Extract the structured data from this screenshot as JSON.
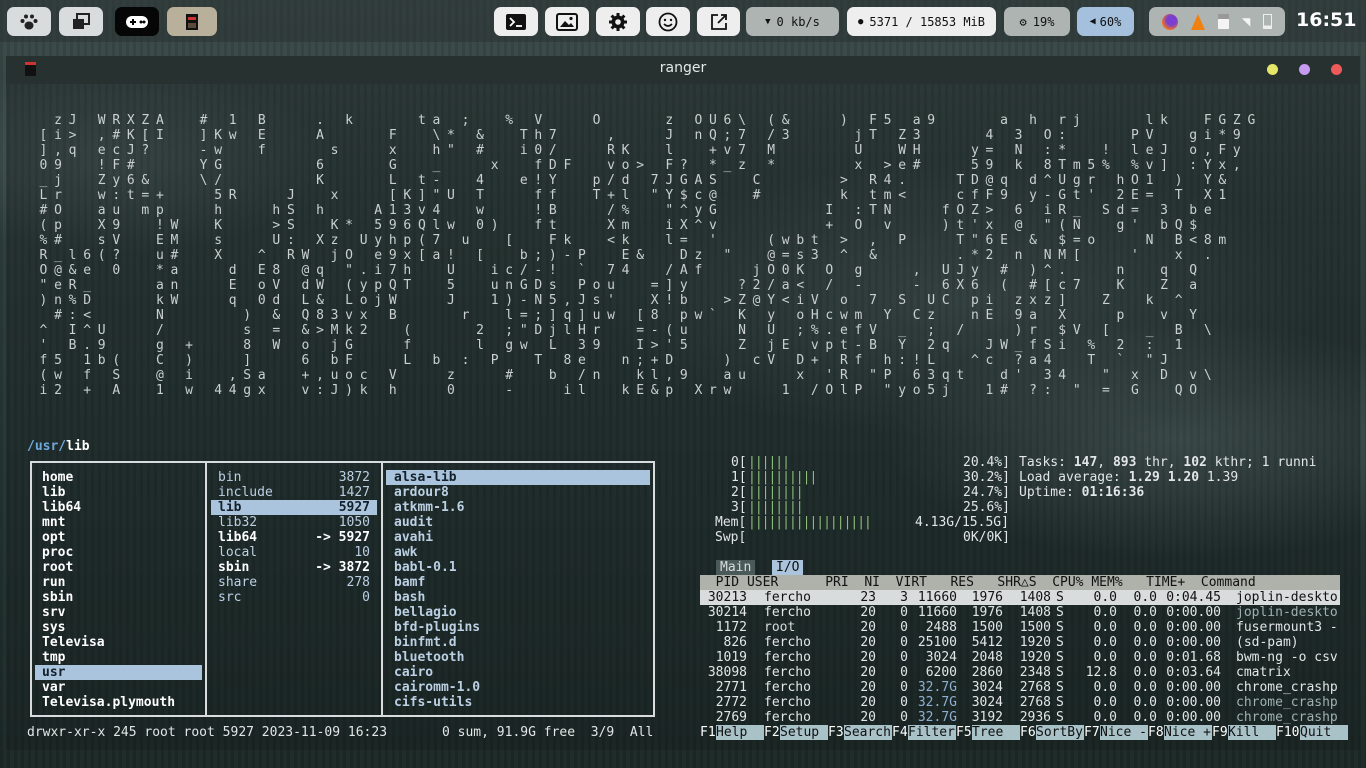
{
  "topbar": {
    "left_buttons": [
      {
        "name": "paw-icon"
      },
      {
        "name": "windows-icon"
      },
      {
        "name": "gamepad-icon"
      },
      {
        "name": "ranger-app-icon"
      }
    ],
    "middle_buttons": [
      {
        "name": "terminal-icon"
      },
      {
        "name": "image-icon"
      },
      {
        "name": "gear-icon"
      },
      {
        "name": "smile-icon"
      },
      {
        "name": "external-link-icon"
      }
    ],
    "network": "0 kb/s",
    "memory": "5371 / 15853 MiB",
    "cpu": "19%",
    "volume": "60%",
    "clock": "16:51"
  },
  "window": {
    "title": "ranger"
  },
  "matrix_rows": [
    "    z J   W R X Z A     #   1   B       .   k         t a   ;     %   V       O         z   O U 6 \\   ( &       )   F 5   a 9         a   h   r j         l k     F G Z G",
    "  [ i >   , # K [ I     ] K w   E       A         F     \\ *   &     T h 7       ,       J   n Q ; 7   / 3         j T   Z 3         4   3   O :         P V     g i * 9",
    "  ] , q   e c J ?       - w     f         s       x     h \"   #     i 0 /       R K     l     + v 7   M           U     W H       y =   N   : *     !   l e J   o , F y",
    "  0 9     ! F #         Y G             6         G     _       x     f D F     v o >   F ?   * _ z   *           x   > e #       5 9   k   8 T m 5 %   % v ]   : Y x ,",
    "  _ j     Z y 6 &       \\ /             K         L   t -     4     e ! Y     p / d   7 J G A S     C           >   R 4 .       T D @ q   d ^ U g r   h O 1   )   Y &",
    "  L r     w : t = +       5 R       J     x       [ K ] \" U   T       f f     T + l   \" Y $ c @     #           k   t m <       c f F 9   y - G t '   2 E =   T   X 1",
    "  # O     a u   m p       h       h S   h       A 1 3 v 4     w       ! B       / %     \" ^ y G               I   : T N       f O Z >   6   i R _   S d =   3   b e",
    "  ( p     X 9     ! W     K       > S     K *   5 9 6 Q l w   0 )     f t       X m     i X ^ v               +   O   v       ) t ' x   @   \" ( N     g '   b Q $",
    "  % #     s V     E M     s       U :   X z   U y h p ( 7   u     [     F k     < k     l =   '       ( w b t   >   ,   P       T \" 6 E   &   $ = o       N   B < 8 m",
    "  R _ l 6 ( ?     u #     X     ^   R W   j O   e 9 x [ a !   [     b ; ) - P     E &     D z   \"     @ = s 3   ^   &           . * 2   n   N M [       '     x   .",
    "  O @ & e   0     * a       d   E 8   @ q   \" . i 7 h     U     i c / - !   `   7 4     / A f       j O 0 K   O   g       ,   U J y   #   ) ^ .       n     q   Q",
    "  \" e R _         a n       E   o V   d W   ( y p Q T     5     u n G D s   P o u     = ] y       ? 2 / a <   /   -       -   6 X 6   (   # [ c 7     K     Z   a",
    "  ) n % D         k W       q   0 d   L &   L o j W       J     1 ) - N 5 , J s '     X ! b     > Z @ Y < i V   o   7   S   U C   p i   z x z ]     Z     k   ^",
    "    # : <         N           )   &   Q 8 3 v x   B         r     l = ; ] q ] u w   [ 8   p w `   K   y   o H c w m   Y   C z     n E   9 a   X       p     v   Y",
    "  ^   I ^ U       /           s   =   & > M k 2     (         2   ; \" D j l H r     = - ( u       N   U   ; % . e f V   _   ;   /       ) r   $ V   [     _   B   \\",
    "  '   B . 9       g   +       8   W   o   j G       f         l   g w   L   3 9     I > ' 5       Z   j E   v p t - B   Y   2 q     J W _ f S i   %   2   :   1",
    "  f 5   1 b (     C   )       ]       6   b F       L   b   :   P     T   8 e     n ; + D       )   c V   D +   R f   h : ! L     ^ c   ? a 4     T   `   \" J",
    "  ( w   f   S     @   i     , S a     + , u o c   V       z       #     b   / n     k l , 9     a u       x   ' R   \" P   6 3 q t     d '   3 4     \"   x   D   v \\",
    "  i 2   +   A     1   w   4 4 g x     v : J ) k   h       0       -       i l     k E & p   X r w       1   / O l P   \" y o 5 j     1 #   ? :   \"   =   G     Q O"
  ],
  "ranger": {
    "path_prefix": "/usr/",
    "path_current": "lib",
    "col1": [
      "home",
      "lib",
      "lib64",
      "mnt",
      "opt",
      "proc",
      "root",
      "run",
      "sbin",
      "srv",
      "sys",
      "Televisa",
      "tmp",
      "usr",
      "var",
      "Televisa.plymouth"
    ],
    "col2": [
      {
        "name": "bin",
        "count": "3872"
      },
      {
        "name": "include",
        "count": "1427"
      },
      {
        "name": "lib",
        "count": "5927"
      },
      {
        "name": "lib32",
        "count": "1050"
      },
      {
        "name": "lib64",
        "count": "-> 5927"
      },
      {
        "name": "local",
        "count": "10"
      },
      {
        "name": "sbin",
        "count": "-> 3872"
      },
      {
        "name": "share",
        "count": "278"
      },
      {
        "name": "src",
        "count": "0"
      }
    ],
    "col3": [
      "alsa-lib",
      "ardour8",
      "atkmm-1.6",
      "audit",
      "avahi",
      "awk",
      "babl-0.1",
      "bamf",
      "bash",
      "bellagio",
      "bfd-plugins",
      "binfmt.d",
      "bluetooth",
      "cairo",
      "cairomm-1.0",
      "cifs-utils"
    ],
    "status_left": "drwxr-xr-x 245 root root 5927 2023-11-09 16:23",
    "status_right": "0 sum, 91.9G free  3/9  All"
  },
  "htop": {
    "cpus": [
      {
        "label": "0[",
        "bar": "||||||",
        "pct": "20.4%]"
      },
      {
        "label": "1[",
        "bar": "||||||||||",
        "pct": "30.2%]"
      },
      {
        "label": "2[",
        "bar": "||||||||",
        "pct": "24.7%]"
      },
      {
        "label": "3[",
        "bar": "||||||||",
        "pct": "25.6%]"
      }
    ],
    "mem": {
      "label": "Mem[",
      "bar": "||||||||||||||||||",
      "val": "4.13G/15.5G]"
    },
    "swp": {
      "label": "Swp[",
      "val": "0K/0K]"
    },
    "tasks_prefix": "Tasks: ",
    "tasks_a": "147",
    "tasks_mid": ", ",
    "tasks_b": "893",
    "tasks_mid2": " thr, ",
    "tasks_c": "102",
    "tasks_suffix": " kthr; 1 runni",
    "load_prefix": "Load average: ",
    "load_1": "1.29",
    "load_5": "1.20",
    "load_15": "1.39",
    "uptime_prefix": "Uptime: ",
    "uptime": "01:16:36",
    "tabs": [
      "Main",
      "I/O"
    ],
    "header": "  PID USER      PRI  NI  VIRT   RES   SHR△S  CPU% MEM%   TIME+  Command",
    "processes": [
      {
        "pid": "30213",
        "user": "fercho",
        "pri": "23",
        "ni": "3",
        "virt": "11660",
        "res": "1976",
        "shr": "1408",
        "s": "S",
        "cpu": "0.0",
        "mem": "0.0",
        "time": "0:04.45",
        "cmd": "joplin-deskto"
      },
      {
        "pid": "30214",
        "user": "fercho",
        "pri": "20",
        "ni": "0",
        "virt": "11660",
        "res": "1976",
        "shr": "1408",
        "s": "S",
        "cpu": "0.0",
        "mem": "0.0",
        "time": "0:00.00",
        "cmd": "joplin-deskto"
      },
      {
        "pid": "1172",
        "user": "root",
        "pri": "20",
        "ni": "0",
        "virt": "2488",
        "res": "1500",
        "shr": "1500",
        "s": "S",
        "cpu": "0.0",
        "mem": "0.0",
        "time": "0:00.00",
        "cmd": "fusermount3 -"
      },
      {
        "pid": "826",
        "user": "fercho",
        "pri": "20",
        "ni": "0",
        "virt": "25100",
        "res": "5412",
        "shr": "1920",
        "s": "S",
        "cpu": "0.0",
        "mem": "0.0",
        "time": "0:00.00",
        "cmd": "(sd-pam)"
      },
      {
        "pid": "1019",
        "user": "fercho",
        "pri": "20",
        "ni": "0",
        "virt": "3024",
        "res": "2048",
        "shr": "1920",
        "s": "S",
        "cpu": "0.0",
        "mem": "0.0",
        "time": "0:01.68",
        "cmd": "bwm-ng -o csv"
      },
      {
        "pid": "38098",
        "user": "fercho",
        "pri": "20",
        "ni": "0",
        "virt": "6200",
        "res": "2860",
        "shr": "2348",
        "s": "S",
        "cpu": "12.8",
        "mem": "0.0",
        "time": "0:03.64",
        "cmd": "cmatrix"
      },
      {
        "pid": "2771",
        "user": "fercho",
        "pri": "20",
        "ni": "0",
        "virt": "32.7G",
        "res": "3024",
        "shr": "2768",
        "s": "S",
        "cpu": "0.0",
        "mem": "0.0",
        "time": "0:00.00",
        "cmd": "chrome_crashp"
      },
      {
        "pid": "2772",
        "user": "fercho",
        "pri": "20",
        "ni": "0",
        "virt": "32.7G",
        "res": "3024",
        "shr": "2768",
        "s": "S",
        "cpu": "0.0",
        "mem": "0.0",
        "time": "0:00.00",
        "cmd": "chrome_crashp"
      },
      {
        "pid": "2769",
        "user": "fercho",
        "pri": "20",
        "ni": "0",
        "virt": "32.7G",
        "res": "3192",
        "shr": "2936",
        "s": "S",
        "cpu": "0.0",
        "mem": "0.0",
        "time": "0:00.00",
        "cmd": "chrome_crashp"
      }
    ],
    "fkeys": [
      {
        "n": "F1",
        "l": "Help  "
      },
      {
        "n": "F2",
        "l": "Setup "
      },
      {
        "n": "F3",
        "l": "Search"
      },
      {
        "n": "F4",
        "l": "Filter"
      },
      {
        "n": "F5",
        "l": "Tree  "
      },
      {
        "n": "F6",
        "l": "SortBy"
      },
      {
        "n": "F7",
        "l": "Nice -"
      },
      {
        "n": "F8",
        "l": "Nice +"
      },
      {
        "n": "F9",
        "l": "Kill  "
      },
      {
        "n": "F10",
        "l": "Quit  "
      }
    ]
  },
  "colors": {
    "accent": "#a9c4dc",
    "bars": "#8ec07c"
  }
}
